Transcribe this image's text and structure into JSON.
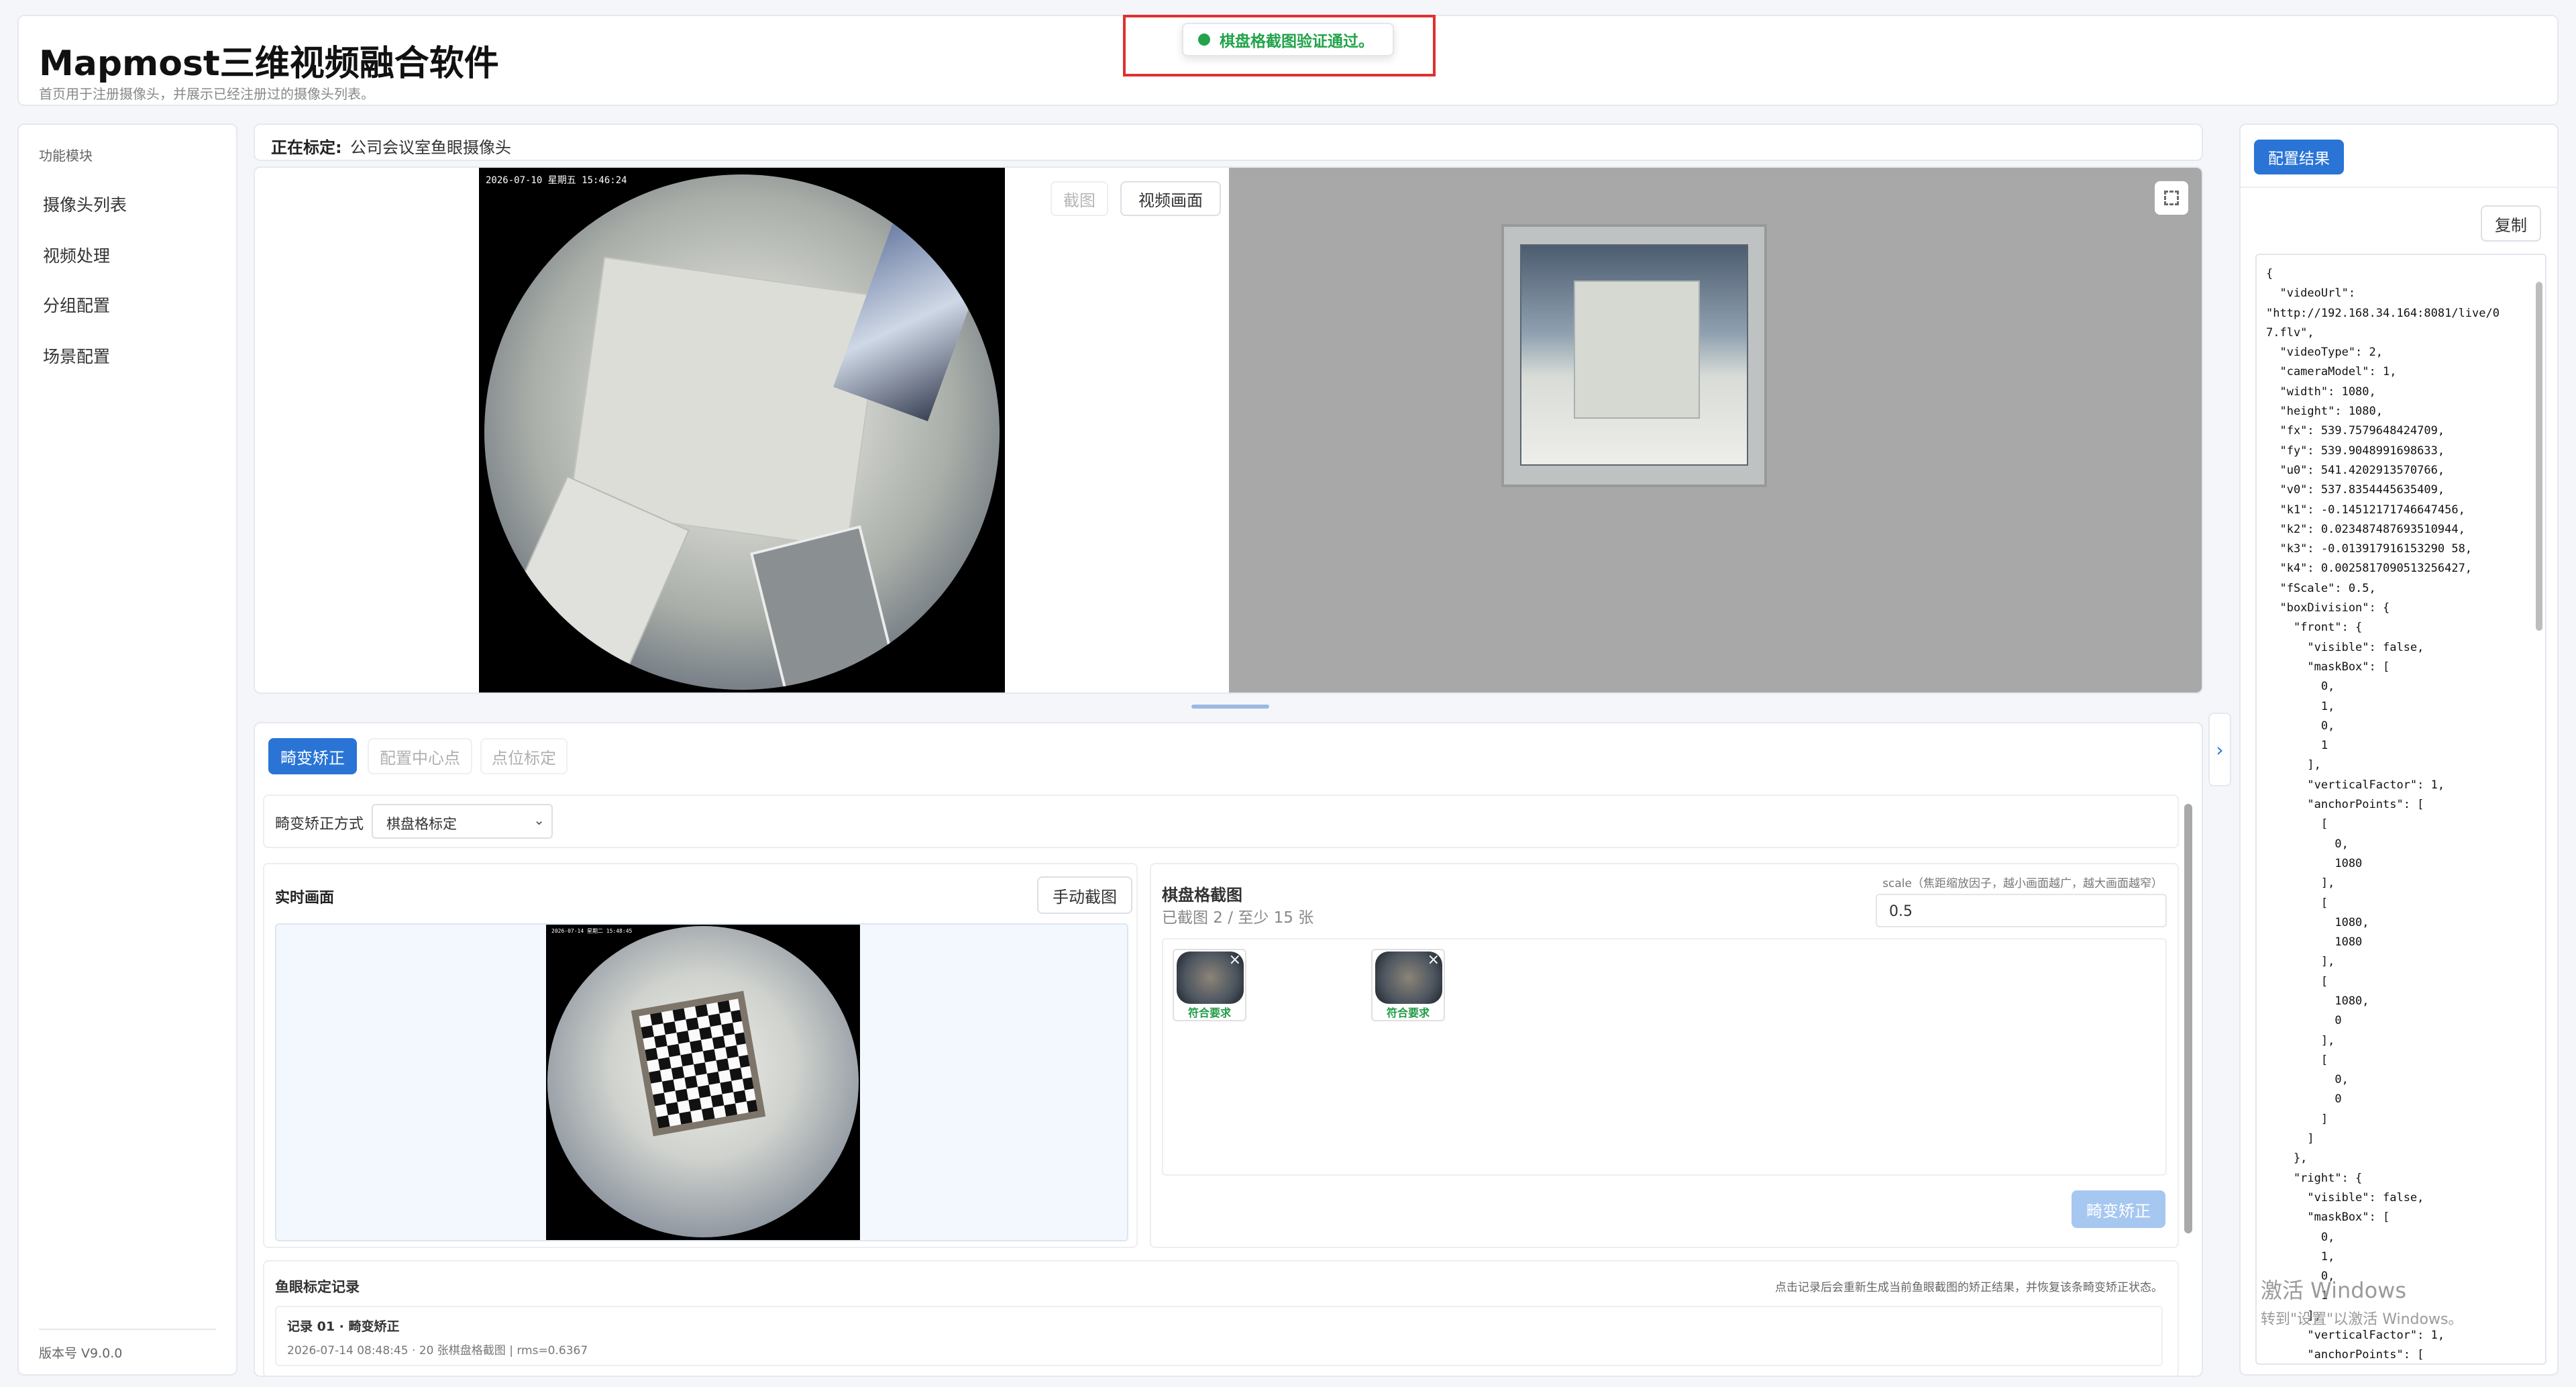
{
  "app": {
    "title": "Mapmost三维视频融合软件",
    "subtitle": "首页用于注册摄像头，并展示已经注册过的摄像头列表。"
  },
  "toast": {
    "message": "棋盘格截图验证通过。",
    "color": "#22a34a"
  },
  "sidebar": {
    "section_label": "功能模块",
    "items": [
      {
        "label": "摄像头列表"
      },
      {
        "label": "视频处理"
      },
      {
        "label": "分组配置"
      },
      {
        "label": "场景配置"
      }
    ],
    "version": "版本号 V9.0.0"
  },
  "calibrating": {
    "label": "正在标定:",
    "value": "公司会议室鱼眼摄像头"
  },
  "preview": {
    "timestamp": "2026-07-10 星期五 15:46:24",
    "screenshot_btn": "截图",
    "video_btn": "视频画面"
  },
  "tabs": [
    {
      "label": "畸变矫正",
      "active": true
    },
    {
      "label": "配置中心点",
      "active": false
    },
    {
      "label": "点位标定",
      "active": false
    }
  ],
  "method": {
    "label": "畸变矫正方式",
    "selected": "棋盘格标定"
  },
  "live": {
    "title": "实时画面",
    "capture_btn": "手动截图",
    "timestamp": "2026-07-14 星期二 15:48:45"
  },
  "chessboard": {
    "title": "棋盘格截图",
    "count": "已截图 2 / 至少 15 张",
    "scale_hint": "scale（焦距缩放因子，越小画面越广，越大画面越窄）",
    "scale_value": "0.5",
    "thumbs": [
      {
        "badge": "符合要求"
      },
      {
        "badge": "符合要求"
      }
    ],
    "correct_btn": "畸变矫正"
  },
  "records": {
    "title": "鱼眼标定记录",
    "hint": "点击记录后会重新生成当前鱼眼截图的矫正结果，并恢复该条畸变矫正状态。",
    "items": [
      {
        "title": "记录 01 · 畸变矫正",
        "meta": "2026-07-14 08:48:45 · 20 张棋盘格截图 | rms=0.6367"
      }
    ]
  },
  "config": {
    "tab": "配置结果",
    "copy_btn": "复制",
    "json_lines": [
      "{",
      "  \"videoUrl\":",
      "\"http://192.168.34.164:8081/live/0",
      "7.flv\",",
      "  \"videoType\": 2,",
      "  \"cameraModel\": 1,",
      "  \"width\": 1080,",
      "  \"height\": 1080,",
      "  \"fx\": 539.7579648424709,",
      "  \"fy\": 539.9048991698633,",
      "  \"u0\": 541.4202913570766,",
      "  \"v0\": 537.8354445635409,",
      "  \"k1\": -0.14512171746647456,",
      "  \"k2\": 0.023487487693510944,",
      "  \"k3\": -0.013917916153290 58,",
      "  \"k4\": 0.0025817090513256427,",
      "  \"fScale\": 0.5,",
      "  \"boxDivision\": {",
      "    \"front\": {",
      "      \"visible\": false,",
      "      \"maskBox\": [",
      "        0,",
      "        1,",
      "        0,",
      "        1",
      "      ],",
      "      \"verticalFactor\": 1,",
      "      \"anchorPoints\": [",
      "        [",
      "          0,",
      "          1080",
      "        ],",
      "        [",
      "          1080,",
      "          1080",
      "        ],",
      "        [",
      "          1080,",
      "          0",
      "        ],",
      "        [",
      "          0,",
      "          0",
      "        ]",
      "      ]",
      "    },",
      "    \"right\": {",
      "      \"visible\": false,",
      "      \"maskBox\": [",
      "        0,",
      "        1,",
      "        0,",
      "        1",
      "      ],",
      "      \"verticalFactor\": 1,",
      "      \"anchorPoints\": ["
    ]
  },
  "watermark": {
    "line1": "激活 Windows",
    "line2": "转到\"设置\"以激活 Windows。"
  }
}
